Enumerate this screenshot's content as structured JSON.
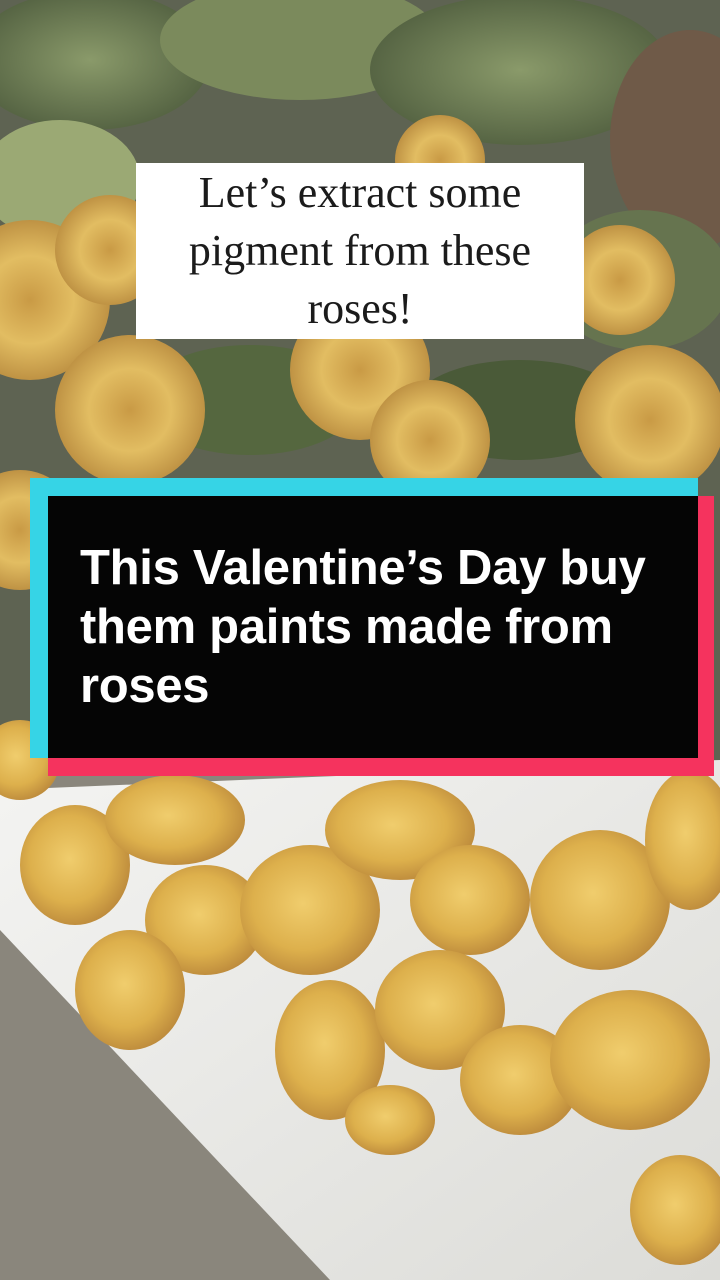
{
  "video": {
    "caption_top": "Let’s extract some pigment from these roses!",
    "caption_banner": "This Valentine’s Day buy them paints made from roses"
  },
  "colors": {
    "banner_cyan": "#36d4e6",
    "banner_red": "#f5335e",
    "banner_fill": "#050505",
    "caption_box": "#ffffff"
  }
}
